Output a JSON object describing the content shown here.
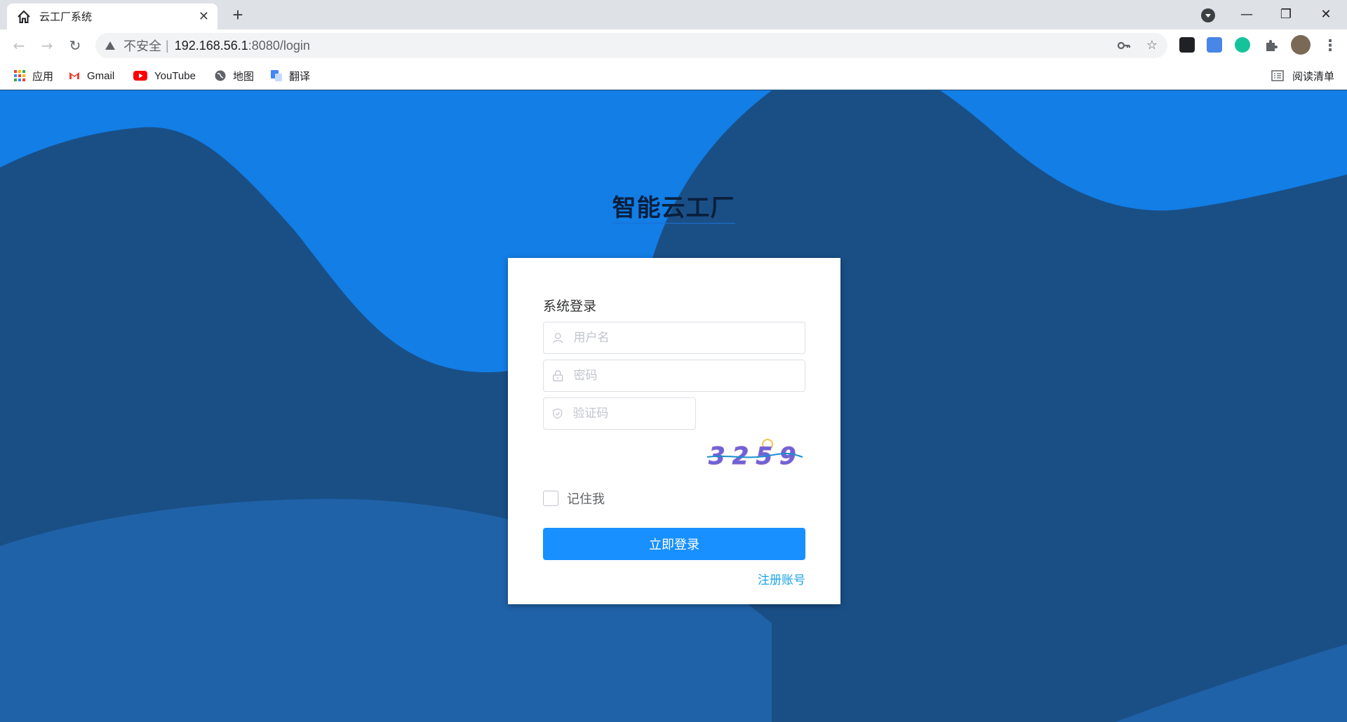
{
  "browser": {
    "tab_title": "云工厂系统",
    "tab_close": "✕",
    "new_tab": "+",
    "window_controls": {
      "minimize": "—",
      "restore": "❐",
      "close": "✕"
    },
    "security_label": "不安全",
    "separator": "|",
    "url_host": "192.168.56.1",
    "url_path": ":8080/login",
    "bookmarks": [
      {
        "label": "应用",
        "icon": "apps-grid-icon"
      },
      {
        "label": "Gmail",
        "icon": "gmail-icon"
      },
      {
        "label": "YouTube",
        "icon": "youtube-icon"
      },
      {
        "label": "地图",
        "icon": "maps-globe-icon"
      },
      {
        "label": "翻译",
        "icon": "translate-icon"
      }
    ],
    "reading_list": "阅读清单"
  },
  "page": {
    "site_title": "智能云工厂",
    "login": {
      "title": "系统登录",
      "username_placeholder": "用户名",
      "password_placeholder": "密码",
      "captcha_placeholder": "验证码",
      "captcha_text": "3259",
      "remember_label": "记住我",
      "submit_label": "立即登录",
      "register_label": "注册账号"
    }
  },
  "colors": {
    "wave_light": "#127ee6",
    "wave_dark": "#1a4f86",
    "wave_bottom": "#2062a8",
    "primary_button": "#1890ff",
    "link": "#1aa3e8"
  }
}
